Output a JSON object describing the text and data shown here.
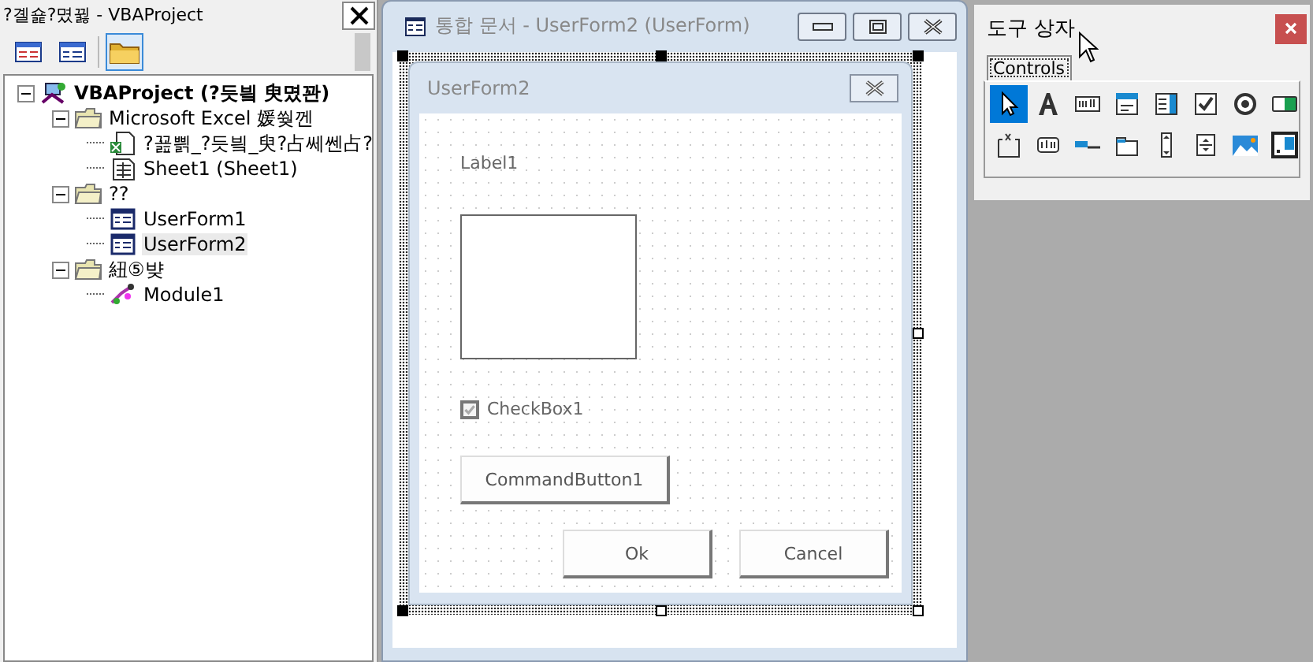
{
  "explorer": {
    "title": "?곌숉?몄뀛 - VBAProject",
    "toolbar": [
      {
        "selected": false
      },
      {
        "selected": false
      },
      {
        "selected": true
      }
    ],
    "tree": [
      {
        "label": "VBAProject (?듯빀 臾몄꽌)",
        "kind": "project",
        "expanded": true,
        "selected": false,
        "children": [
          {
            "label": "Microsoft Excel 媛쒖껜",
            "kind": "folder",
            "expanded": true,
            "selected": false,
            "children": [
              {
                "label": "?꾪쁽_?듯빀_臾?占쎄쎈占?",
                "kind": "workbook",
                "selected": false
              },
              {
                "label": "Sheet1 (Sheet1)",
                "kind": "sheet",
                "selected": false
              }
            ]
          },
          {
            "label": "??",
            "kind": "folder",
            "expanded": true,
            "selected": false,
            "children": [
              {
                "label": "UserForm1",
                "kind": "form",
                "selected": false
              },
              {
                "label": "UserForm2",
                "kind": "form",
                "selected": true
              }
            ]
          },
          {
            "label": "紐⑤뱢",
            "kind": "folder",
            "expanded": true,
            "selected": false,
            "children": [
              {
                "label": "Module1",
                "kind": "module",
                "selected": false
              }
            ]
          }
        ]
      }
    ]
  },
  "designer": {
    "title": "통합 문서 - UserForm2 (UserForm)",
    "form": {
      "title": "UserForm2",
      "label": "Label1",
      "checkbox": {
        "label": "CheckBox1",
        "checked": true
      },
      "command_button": "CommandButton1",
      "buttons": [
        "Ok",
        "Cancel"
      ]
    }
  },
  "toolbox": {
    "title": "도구 상자",
    "tab": "Controls",
    "tools": [
      {
        "selected": true
      },
      {
        "selected": false
      },
      {
        "selected": false
      },
      {
        "selected": false
      },
      {
        "selected": false
      },
      {
        "selected": false
      },
      {
        "selected": false
      },
      {
        "selected": false
      },
      {
        "selected": false
      },
      {
        "selected": false
      },
      {
        "selected": false
      },
      {
        "selected": false
      },
      {
        "selected": false
      },
      {
        "selected": false
      },
      {
        "selected": false
      },
      {
        "selected": false
      }
    ]
  }
}
